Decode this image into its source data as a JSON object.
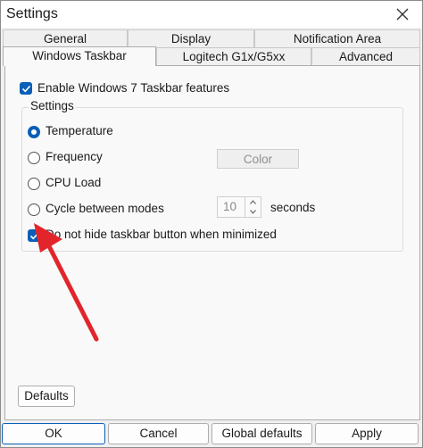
{
  "window": {
    "title": "Settings"
  },
  "tabs": [
    {
      "label": "General"
    },
    {
      "label": "Display"
    },
    {
      "label": "Notification Area"
    },
    {
      "label": "Windows Taskbar"
    },
    {
      "label": "Logitech G1x/G5xx"
    },
    {
      "label": "Advanced"
    }
  ],
  "active_tab": "Windows Taskbar",
  "enable_checkbox": {
    "label": "Enable Windows 7 Taskbar features",
    "checked": true
  },
  "settings_group": {
    "title": "Settings",
    "radios": [
      {
        "label": "Temperature",
        "checked": true
      },
      {
        "label": "Frequency",
        "checked": false
      },
      {
        "label": "CPU Load",
        "checked": false
      },
      {
        "label": "Cycle between modes",
        "checked": false
      }
    ],
    "color_button": "Color",
    "cycle_value": "10",
    "cycle_unit": "seconds",
    "hide_checkbox": {
      "label": "Do not hide taskbar button when minimized",
      "checked": true
    }
  },
  "defaults_button": "Defaults",
  "footer": {
    "ok": "OK",
    "cancel": "Cancel",
    "global_defaults": "Global defaults",
    "apply": "Apply"
  },
  "colors": {
    "accent": "#0a5fb6",
    "annotation_arrow": "#e2252b"
  }
}
